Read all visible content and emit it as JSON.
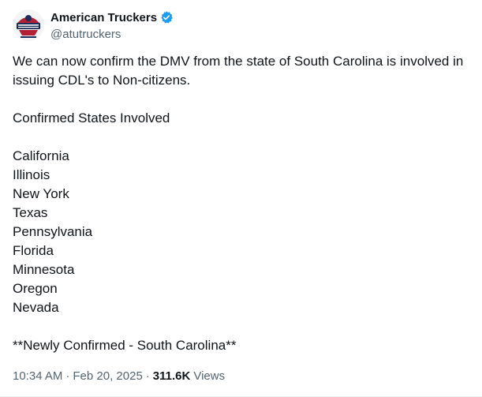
{
  "author": {
    "display_name": "American Truckers",
    "handle": "@atutruckers",
    "verified_icon": "verified-badge-icon",
    "avatar_icon": "atu-logo-icon",
    "verified_color": "#1d9bf0"
  },
  "tweet": {
    "intro": "We can now confirm the DMV from the state of South Carolina is involved in issuing CDL's to Non-citizens.",
    "list_heading": "Confirmed States Involved",
    "states": [
      "California",
      "Illinois",
      "New York",
      "Texas",
      "Pennsylvania",
      "Florida",
      "Minnesota",
      "Oregon",
      "Nevada"
    ],
    "closing": "**Newly Confirmed - South Carolina**"
  },
  "meta": {
    "time": "10:34 AM",
    "separator": "·",
    "date": "Feb 20, 2025",
    "views_count": "311.6K",
    "views_label": "Views"
  }
}
